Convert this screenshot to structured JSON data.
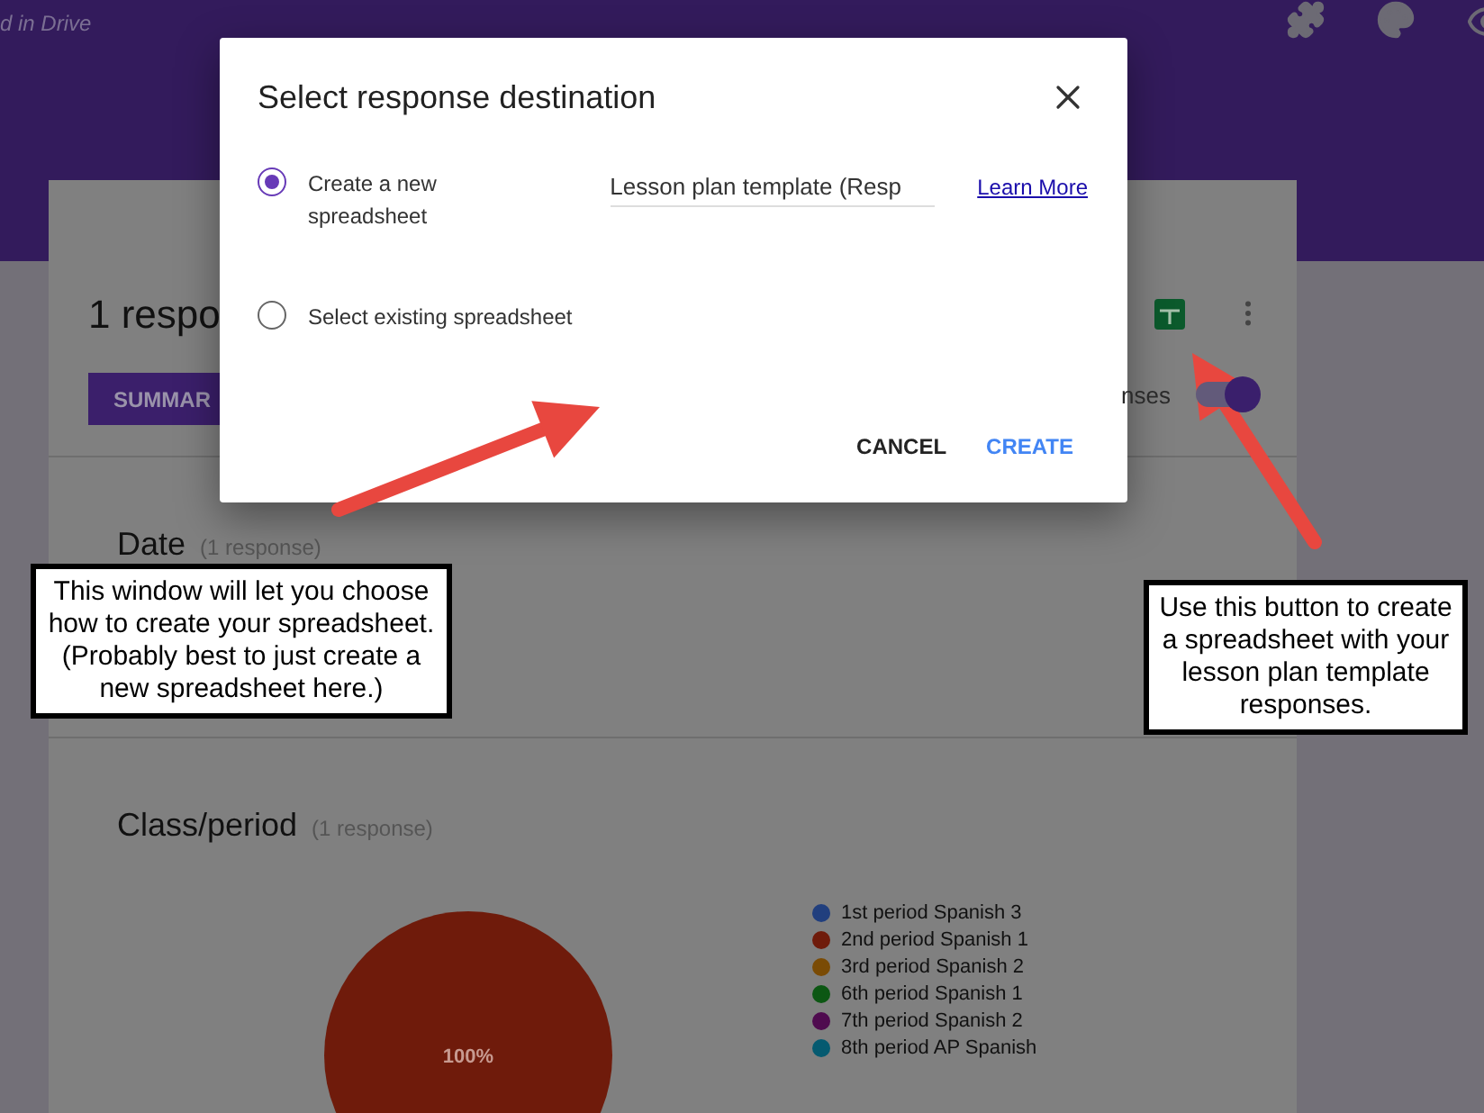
{
  "header": {
    "caption": "d in Drive"
  },
  "summary": {
    "count_title": "1 respo",
    "tab_label": "SUMMAR",
    "accepting_label": "nses",
    "accepting": {
      "on": true
    }
  },
  "questions": [
    {
      "title": "Date",
      "count": "(1 response)"
    },
    {
      "title": "Class/period",
      "count": "(1 response)",
      "slice_label": "100%",
      "legend": [
        {
          "color": "#213f7e"
        },
        {
          "color": "#6f1b0b"
        },
        {
          "color": "#7a4b05"
        },
        {
          "color": "#0c5713"
        },
        {
          "color": "#4f0b4f"
        },
        {
          "color": "#055a70"
        }
      ],
      "chart_data": {
        "type": "pie",
        "categories": [
          "1st period Spanish 3",
          "2nd period Spanish 1",
          "3rd period Spanish 2",
          "6th period Spanish 1",
          "7th period Spanish 2",
          "8th period AP Spanish"
        ],
        "values": [
          0,
          1,
          0,
          0,
          0,
          0
        ]
      }
    }
  ],
  "dialog": {
    "title": "Select response destination",
    "options": [
      {
        "label": "Create a new spreadsheet",
        "selected": true,
        "field_value": "Lesson plan template (Resp",
        "link": "Learn More"
      },
      {
        "label": "Select existing spreadsheet",
        "selected": false
      }
    ],
    "buttons": [
      {
        "label": "CANCEL",
        "kind": "plain"
      },
      {
        "label": "CREATE",
        "kind": "primary"
      }
    ]
  },
  "callouts": [
    {
      "text": "This window will let you choose how to create your spreadsheet. (Probably best to just create a new spreadsheet here.)"
    },
    {
      "text": "Use this button to create a spreadsheet with your lesson plan template responses."
    }
  ]
}
